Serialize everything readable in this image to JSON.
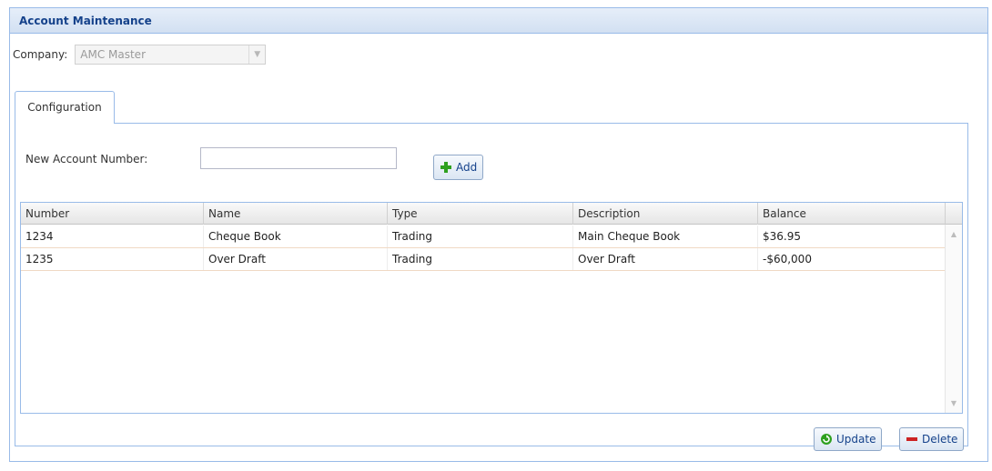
{
  "panel": {
    "title": "Account Maintenance"
  },
  "company": {
    "label": "Company:",
    "value": "AMC Master"
  },
  "tabs": [
    {
      "label": "Configuration",
      "active": true
    }
  ],
  "form": {
    "new_account_label": "New Account Number:",
    "new_account_value": "",
    "add_label": "Add"
  },
  "grid": {
    "columns": [
      "Number",
      "Name",
      "Type",
      "Description",
      "Balance"
    ],
    "rows": [
      [
        "1234",
        "Cheque Book",
        "Trading",
        "Main Cheque Book",
        "$36.95"
      ],
      [
        "1235",
        "Over Draft",
        "Trading",
        "Over Draft",
        "-$60,000"
      ]
    ]
  },
  "actions": {
    "update_label": "Update",
    "delete_label": "Delete"
  },
  "icons": {
    "add": "plus-icon",
    "update": "refresh-icon",
    "delete": "minus-icon",
    "combo": "chevron-down-icon",
    "scroll_up": "scroll-up-icon",
    "scroll_down": "scroll-down-icon"
  },
  "colors": {
    "header_text": "#15428b",
    "border": "#99bbe8",
    "add_green": "#2ea01f",
    "delete_red": "#cc2222"
  }
}
